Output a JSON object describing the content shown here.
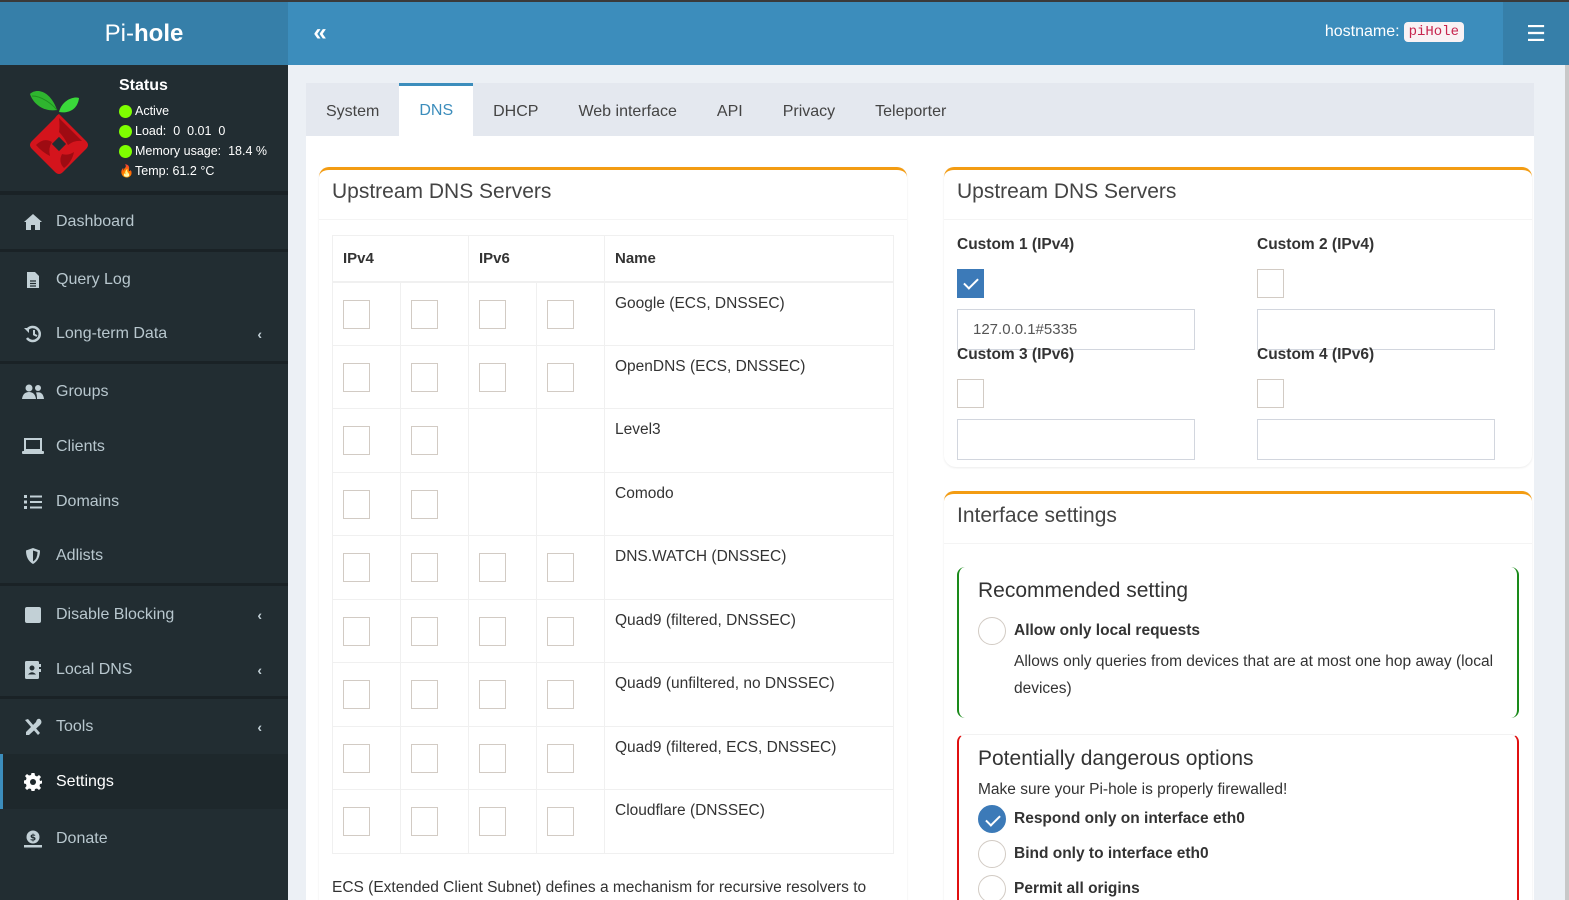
{
  "header": {
    "logo_pi": "Pi-",
    "logo_hole": "hole",
    "collapse_icon": "«",
    "hostname_label": "hostname:",
    "hostname_value": "piHole",
    "menu_icon": "☰"
  },
  "status": {
    "title": "Status",
    "active": "Active",
    "load": "Load:  0  0.01  0",
    "memory": "Memory usage:  18.4 %",
    "temp": "Temp: 61.2 °C"
  },
  "sidebar": {
    "items": [
      {
        "label": "Dashboard",
        "icon": "home-icon"
      },
      {
        "label": "Query Log",
        "icon": "file-icon"
      },
      {
        "label": "Long-term Data",
        "icon": "history-icon",
        "expandable": true
      },
      {
        "label": "Groups",
        "icon": "users-icon"
      },
      {
        "label": "Clients",
        "icon": "laptop-icon"
      },
      {
        "label": "Domains",
        "icon": "list-icon"
      },
      {
        "label": "Adlists",
        "icon": "shield-icon"
      },
      {
        "label": "Disable Blocking",
        "icon": "stop-icon",
        "expandable": true
      },
      {
        "label": "Local DNS",
        "icon": "address-book-icon",
        "expandable": true
      },
      {
        "label": "Tools",
        "icon": "tools-icon",
        "expandable": true
      },
      {
        "label": "Settings",
        "icon": "gear-icon",
        "active": true
      },
      {
        "label": "Donate",
        "icon": "donate-icon"
      }
    ],
    "chevron": "‹"
  },
  "tabs": [
    {
      "label": "System"
    },
    {
      "label": "DNS",
      "active": true
    },
    {
      "label": "DHCP"
    },
    {
      "label": "Web interface"
    },
    {
      "label": "API"
    },
    {
      "label": "Privacy"
    },
    {
      "label": "Teleporter"
    }
  ],
  "upstream_left": {
    "title": "Upstream DNS Servers",
    "columns": {
      "ipv4": "IPv4",
      "ipv6": "IPv6",
      "name": "Name"
    },
    "servers": [
      {
        "name": "Google (ECS, DNSSEC)",
        "ipv4": [
          false,
          false
        ],
        "ipv6": [
          false,
          false
        ],
        "has_ipv6": true
      },
      {
        "name": "OpenDNS (ECS, DNSSEC)",
        "ipv4": [
          false,
          false
        ],
        "ipv6": [
          false,
          false
        ],
        "has_ipv6": true
      },
      {
        "name": "Level3",
        "ipv4": [
          false,
          false
        ],
        "ipv6": [],
        "has_ipv6": false
      },
      {
        "name": "Comodo",
        "ipv4": [
          false,
          false
        ],
        "ipv6": [],
        "has_ipv6": false
      },
      {
        "name": "DNS.WATCH (DNSSEC)",
        "ipv4": [
          false,
          false
        ],
        "ipv6": [
          false,
          false
        ],
        "has_ipv6": true
      },
      {
        "name": "Quad9 (filtered, DNSSEC)",
        "ipv4": [
          false,
          false
        ],
        "ipv6": [
          false,
          false
        ],
        "has_ipv6": true
      },
      {
        "name": "Quad9 (unfiltered, no DNSSEC)",
        "ipv4": [
          false,
          false
        ],
        "ipv6": [
          false,
          false
        ],
        "has_ipv6": true
      },
      {
        "name": "Quad9 (filtered, ECS, DNSSEC)",
        "ipv4": [
          false,
          false
        ],
        "ipv6": [
          false,
          false
        ],
        "has_ipv6": true
      },
      {
        "name": "Cloudflare (DNSSEC)",
        "ipv4": [
          false,
          false
        ],
        "ipv6": [
          false,
          false
        ],
        "has_ipv6": true
      }
    ],
    "ecs_note": "ECS (Extended Client Subnet) defines a mechanism for recursive resolvers to send partial client IP address information to authoritative DNS name servers"
  },
  "upstream_custom": {
    "title": "Upstream DNS Servers",
    "fields": [
      {
        "label": "Custom 1 (IPv4)",
        "checked": true,
        "value": "127.0.0.1#5335"
      },
      {
        "label": "Custom 2 (IPv4)",
        "checked": false,
        "value": ""
      },
      {
        "label": "Custom 3 (IPv6)",
        "checked": false,
        "value": ""
      },
      {
        "label": "Custom 4 (IPv6)",
        "checked": false,
        "value": ""
      }
    ]
  },
  "interface": {
    "title": "Interface settings",
    "recommended": {
      "title": "Recommended setting",
      "option_label": "Allow only local requests",
      "option_checked": false,
      "description": "Allows only queries from devices that are at most one hop away (local devices)"
    },
    "dangerous": {
      "title": "Potentially dangerous options",
      "warning": "Make sure your Pi-hole is properly firewalled!",
      "options": [
        {
          "label": "Respond only on interface eth0",
          "checked": true
        },
        {
          "label": "Bind only to interface eth0",
          "checked": false
        },
        {
          "label": "Permit all origins",
          "checked": false
        }
      ]
    }
  },
  "colors": {
    "primary": "#3c8dbc",
    "sidebar_bg": "#222d32",
    "box_accent": "#f39c12",
    "recommended_border": "#1a8a1a",
    "danger_border": "#e01010",
    "status_ok": "#7fff00"
  }
}
